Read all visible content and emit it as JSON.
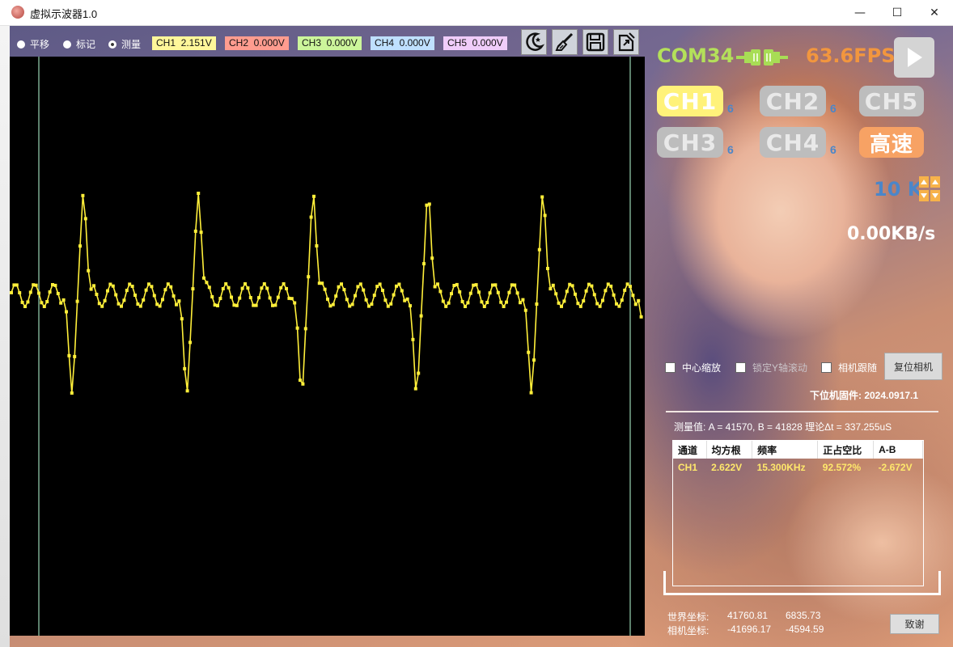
{
  "window": {
    "title": "虚拟示波器1.0",
    "controls": {
      "minimize": "—",
      "maximize": "☐",
      "close": "✕"
    }
  },
  "toolbar": {
    "modes": [
      {
        "label": "平移",
        "selected": false
      },
      {
        "label": "标记",
        "selected": false
      },
      {
        "label": "测量",
        "selected": true
      }
    ],
    "channels": [
      {
        "label": "CH1  2.151V",
        "color": "#fff79a"
      },
      {
        "label": "CH2  0.000V",
        "color": "#ff9c8f"
      },
      {
        "label": "CH3  0.000V",
        "color": "#ccf59b"
      },
      {
        "label": "CH4  0.000V",
        "color": "#bfe0ff"
      },
      {
        "label": "CH5  0.000V",
        "color": "#f0cdfa"
      }
    ],
    "icons": [
      "night-mode-icon",
      "brush-icon",
      "save-icon",
      "export-icon"
    ]
  },
  "scope": {
    "trace_color": "#ffef3a",
    "cursor_color": "#b7ffd8",
    "background": "#000000"
  },
  "status": {
    "port": "COM34",
    "fps": "63.6FPS",
    "rate": "10 K",
    "throughput": "0.00KB/s",
    "port_color": "#b4e05a",
    "fps_color": "#f2963e"
  },
  "channel_buttons": [
    {
      "label": "CH1",
      "count": "6",
      "active": true
    },
    {
      "label": "CH2",
      "count": "6",
      "active": false
    },
    {
      "label": "CH5",
      "count": "",
      "active": false
    },
    {
      "label": "CH3",
      "count": "6",
      "active": false
    },
    {
      "label": "CH4",
      "count": "6",
      "active": false
    },
    {
      "label": "高速",
      "count": "",
      "active": true
    }
  ],
  "options": {
    "center_zoom": "中心缩放",
    "lock_y_scroll": "锁定Y轴滚动",
    "camera_follow": "相机跟随",
    "reset_camera": "复位相机"
  },
  "firmware": "下位机固件:  2024.0917.1",
  "measurement": {
    "summary": "测量值:  A = 41570, B = 41828  理论Δt = 337.255uS",
    "columns": [
      "通道",
      "均方根",
      "频率",
      "正占空比",
      "A-B"
    ],
    "rows": [
      [
        "CH1",
        "2.622V",
        "15.300KHz",
        "92.572%",
        "-2.672V"
      ]
    ]
  },
  "coords": {
    "world_label": "世界坐标:",
    "world_x": "41760.81",
    "world_y": "6835.73",
    "camera_label": "相机坐标:",
    "camera_x": "-41696.17",
    "camera_y": "-4594.59"
  },
  "thanks_button": "致谢"
}
